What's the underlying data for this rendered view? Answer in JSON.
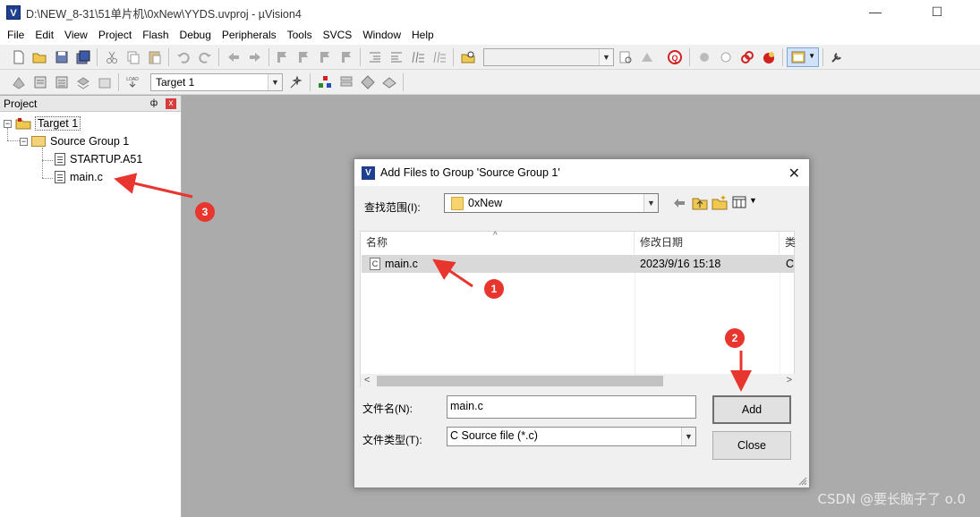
{
  "window": {
    "title": "D:\\NEW_8-31\\51单片机\\0xNew\\YYDS.uvproj - µVision4",
    "app_icon": "V",
    "minimize": "—",
    "maximize": "☐",
    "close": "✕"
  },
  "menubar": {
    "items": [
      "File",
      "Edit",
      "View",
      "Project",
      "Flash",
      "Debug",
      "Peripherals",
      "Tools",
      "SVCS",
      "Window",
      "Help"
    ]
  },
  "toolbar2": {
    "target_select": "Target 1"
  },
  "project_pane": {
    "title": "Project",
    "pin": "ф",
    "close": "x",
    "tree": {
      "target": "Target 1",
      "group": "Source Group 1",
      "files": [
        "STARTUP.A51",
        "main.c"
      ]
    }
  },
  "dialog": {
    "title": "Add Files to Group 'Source Group 1'",
    "icon": "V",
    "close": "✕",
    "lookin_label": "查找范围(I):",
    "lookin_value": "0xNew",
    "columns": {
      "name": "名称",
      "modified": "修改日期",
      "type": "类"
    },
    "files": [
      {
        "icon": "C",
        "name": "main.c",
        "modified": "2023/9/16 15:18",
        "type": "C ü"
      }
    ],
    "filename_label": "文件名(N):",
    "filename_value": "main.c",
    "filetype_label": "文件类型(T):",
    "filetype_value": "C Source file (*.c)",
    "add_button": "Add",
    "close_button": "Close"
  },
  "annotations": {
    "badges": [
      "1",
      "2",
      "3"
    ],
    "color": "#e8352e"
  },
  "watermark": "CSDN @要长脑子了 o.0"
}
